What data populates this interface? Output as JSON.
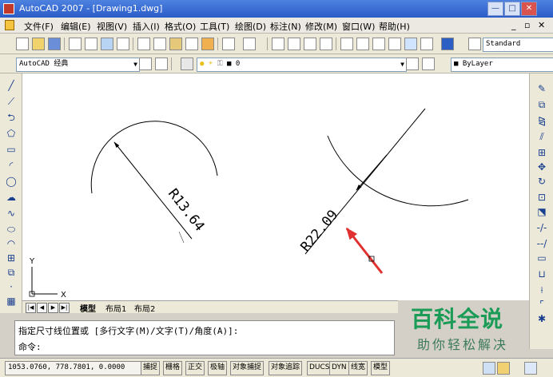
{
  "window": {
    "title": "AutoCAD 2007 - [Drawing1.dwg]"
  },
  "menu": [
    "文件(F)",
    "编辑(E)",
    "视图(V)",
    "插入(I)",
    "格式(O)",
    "工具(T)",
    "绘图(D)",
    "标注(N)",
    "修改(M)",
    "窗口(W)",
    "帮助(H)"
  ],
  "toolbar": {
    "text_style": "Standard",
    "workspace": "AutoCAD 经典",
    "layer": "0",
    "linetype": "ByLayer"
  },
  "drawing": {
    "dim1": "R13.64",
    "dim2": "R22.09",
    "ucs_y": "Y",
    "ucs_x": "X"
  },
  "tabs": {
    "model": "模型",
    "layout1": "布局1",
    "layout2": "布局2"
  },
  "command": {
    "line1": "指定尺寸线位置或 [多行文字(M)/文字(T)/角度(A)]:",
    "line2": "命令:"
  },
  "status": {
    "coords": "1053.0760, 778.7801, 0.0000",
    "buttons": [
      "捕捉",
      "栅格",
      "正交",
      "极轴",
      "对象捕捉",
      "对象追踪",
      "DUCS",
      "DYN",
      "线宽",
      "模型"
    ]
  },
  "watermark": {
    "title": "百科全说",
    "subtitle": "助你轻松解决"
  },
  "colors": {
    "arrow": "#e03030",
    "title_bar": "#2a5bc7",
    "watermark": "#1a9b56"
  }
}
